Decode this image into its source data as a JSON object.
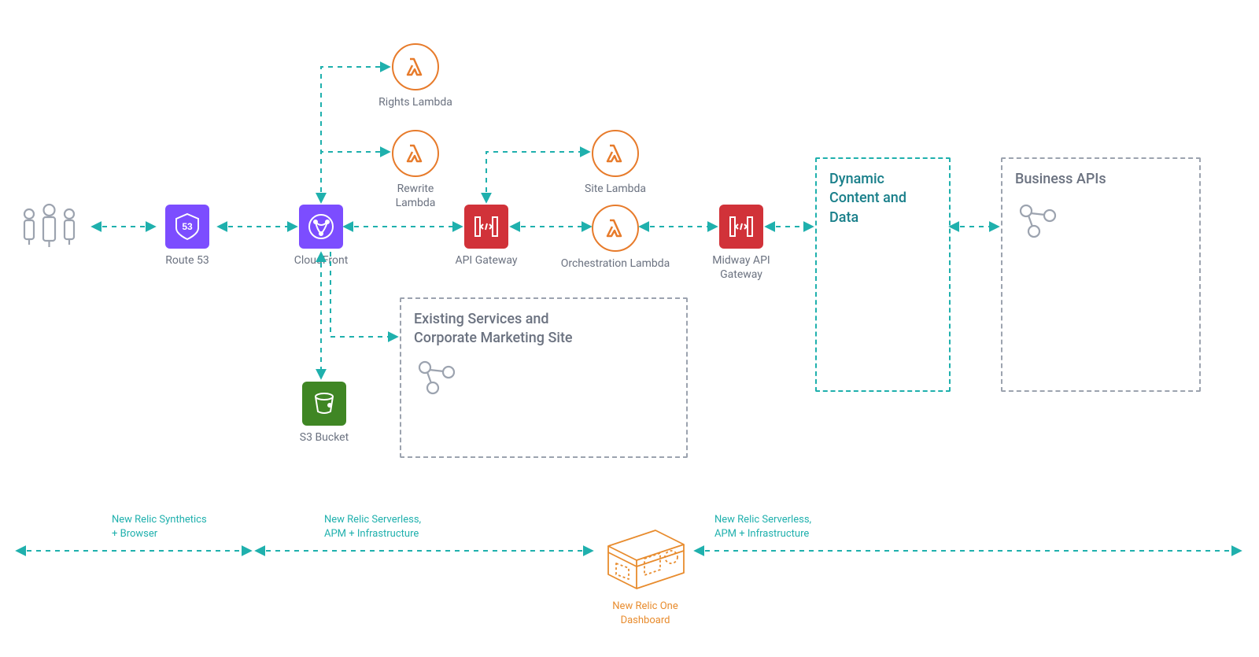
{
  "nodes": {
    "users": {
      "label": ""
    },
    "route53": {
      "label": "Route 53"
    },
    "cloudfront": {
      "label": "CloudFront"
    },
    "rights_lambda": {
      "label": "Rights Lambda"
    },
    "rewrite_lambda": {
      "label": "Rewrite\nLambda"
    },
    "api_gateway": {
      "label": "API Gateway"
    },
    "site_lambda": {
      "label": "Site Lambda"
    },
    "orchestration_lambda": {
      "label": "Orchestration Lambda"
    },
    "midway_api_gateway": {
      "label": "Midway API\nGateway"
    },
    "s3_bucket": {
      "label": "S3 Bucket"
    }
  },
  "boxes": {
    "existing_services": {
      "title": "Existing Services and Corporate Marketing Site"
    },
    "dynamic_content": {
      "title": "Dynamic\nContent and\nData"
    },
    "business_apis": {
      "title": "Business APIs"
    }
  },
  "bottom": {
    "left_caption": "New Relic Synthetics\n+ Browser",
    "mid_caption": "New Relic Serverless,\nAPM + Infrastructure",
    "right_caption": "New Relic Serverless,\nAPM + Infrastructure",
    "dashboard": "New Relic One\nDashboard"
  },
  "colors": {
    "teal": "#1fb0ad",
    "orange": "#e77b2b",
    "purple": "#7c4dff",
    "red": "#d13239",
    "green": "#3f8624",
    "gray": "#6b7280"
  }
}
